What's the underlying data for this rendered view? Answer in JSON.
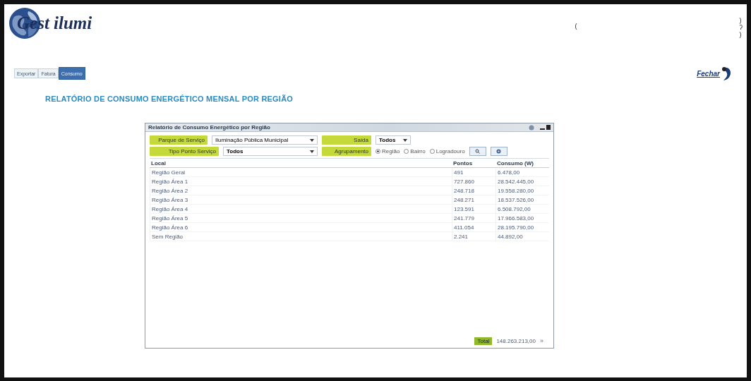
{
  "logo": {
    "text": "Gest ilumi"
  },
  "corner_marks": {
    "top": "(",
    "side": [
      ")",
      "ʔ",
      ")"
    ]
  },
  "tabs": [
    {
      "label": "Exportar",
      "selected": false
    },
    {
      "label": "Fatura",
      "selected": false
    },
    {
      "label": "Consumo",
      "selected": true
    }
  ],
  "close_button": {
    "label": "Fechar"
  },
  "page_title": "RELATÓRIO DE CONSUMO ENERGÉTICO MENSAL POR REGIÃO",
  "window": {
    "title": "Relatório de Consumo Energético por Região"
  },
  "filters": {
    "parque": {
      "label": "Parque de Serviço",
      "value": "Iluminação Pública Municipal"
    },
    "saida": {
      "label": "Saída",
      "value": "Todos"
    },
    "tipo": {
      "label": "Tipo Ponto Serviço",
      "value": "Todos"
    },
    "agrupamento": {
      "label": "Agrupamento",
      "options": [
        {
          "label": "Região",
          "selected": true
        },
        {
          "label": "Bairro",
          "selected": false
        },
        {
          "label": "Logradouro",
          "selected": false
        }
      ]
    }
  },
  "table": {
    "columns": [
      "Local",
      "Pontos",
      "Consumo (W)"
    ],
    "rows": [
      [
        "Região Geral",
        "491",
        "6.478,00"
      ],
      [
        "Região Área 1",
        "727.860",
        "28.542.445,00"
      ],
      [
        "Região Área 2",
        "248.718",
        "19.558.280,00"
      ],
      [
        "Região Área 3",
        "248.271",
        "18.537.526,00"
      ],
      [
        "Região Área 4",
        "123.591",
        "6.508.792,00"
      ],
      [
        "Região Área 5",
        "241.779",
        "17.966.583,00"
      ],
      [
        "Região Área 6",
        "411.054",
        "28.195.790,00"
      ],
      [
        "Sem Região",
        "2.241",
        "44.892,00"
      ]
    ]
  },
  "total": {
    "label": "Total",
    "value": "148.263.213,00",
    "more": "»"
  }
}
